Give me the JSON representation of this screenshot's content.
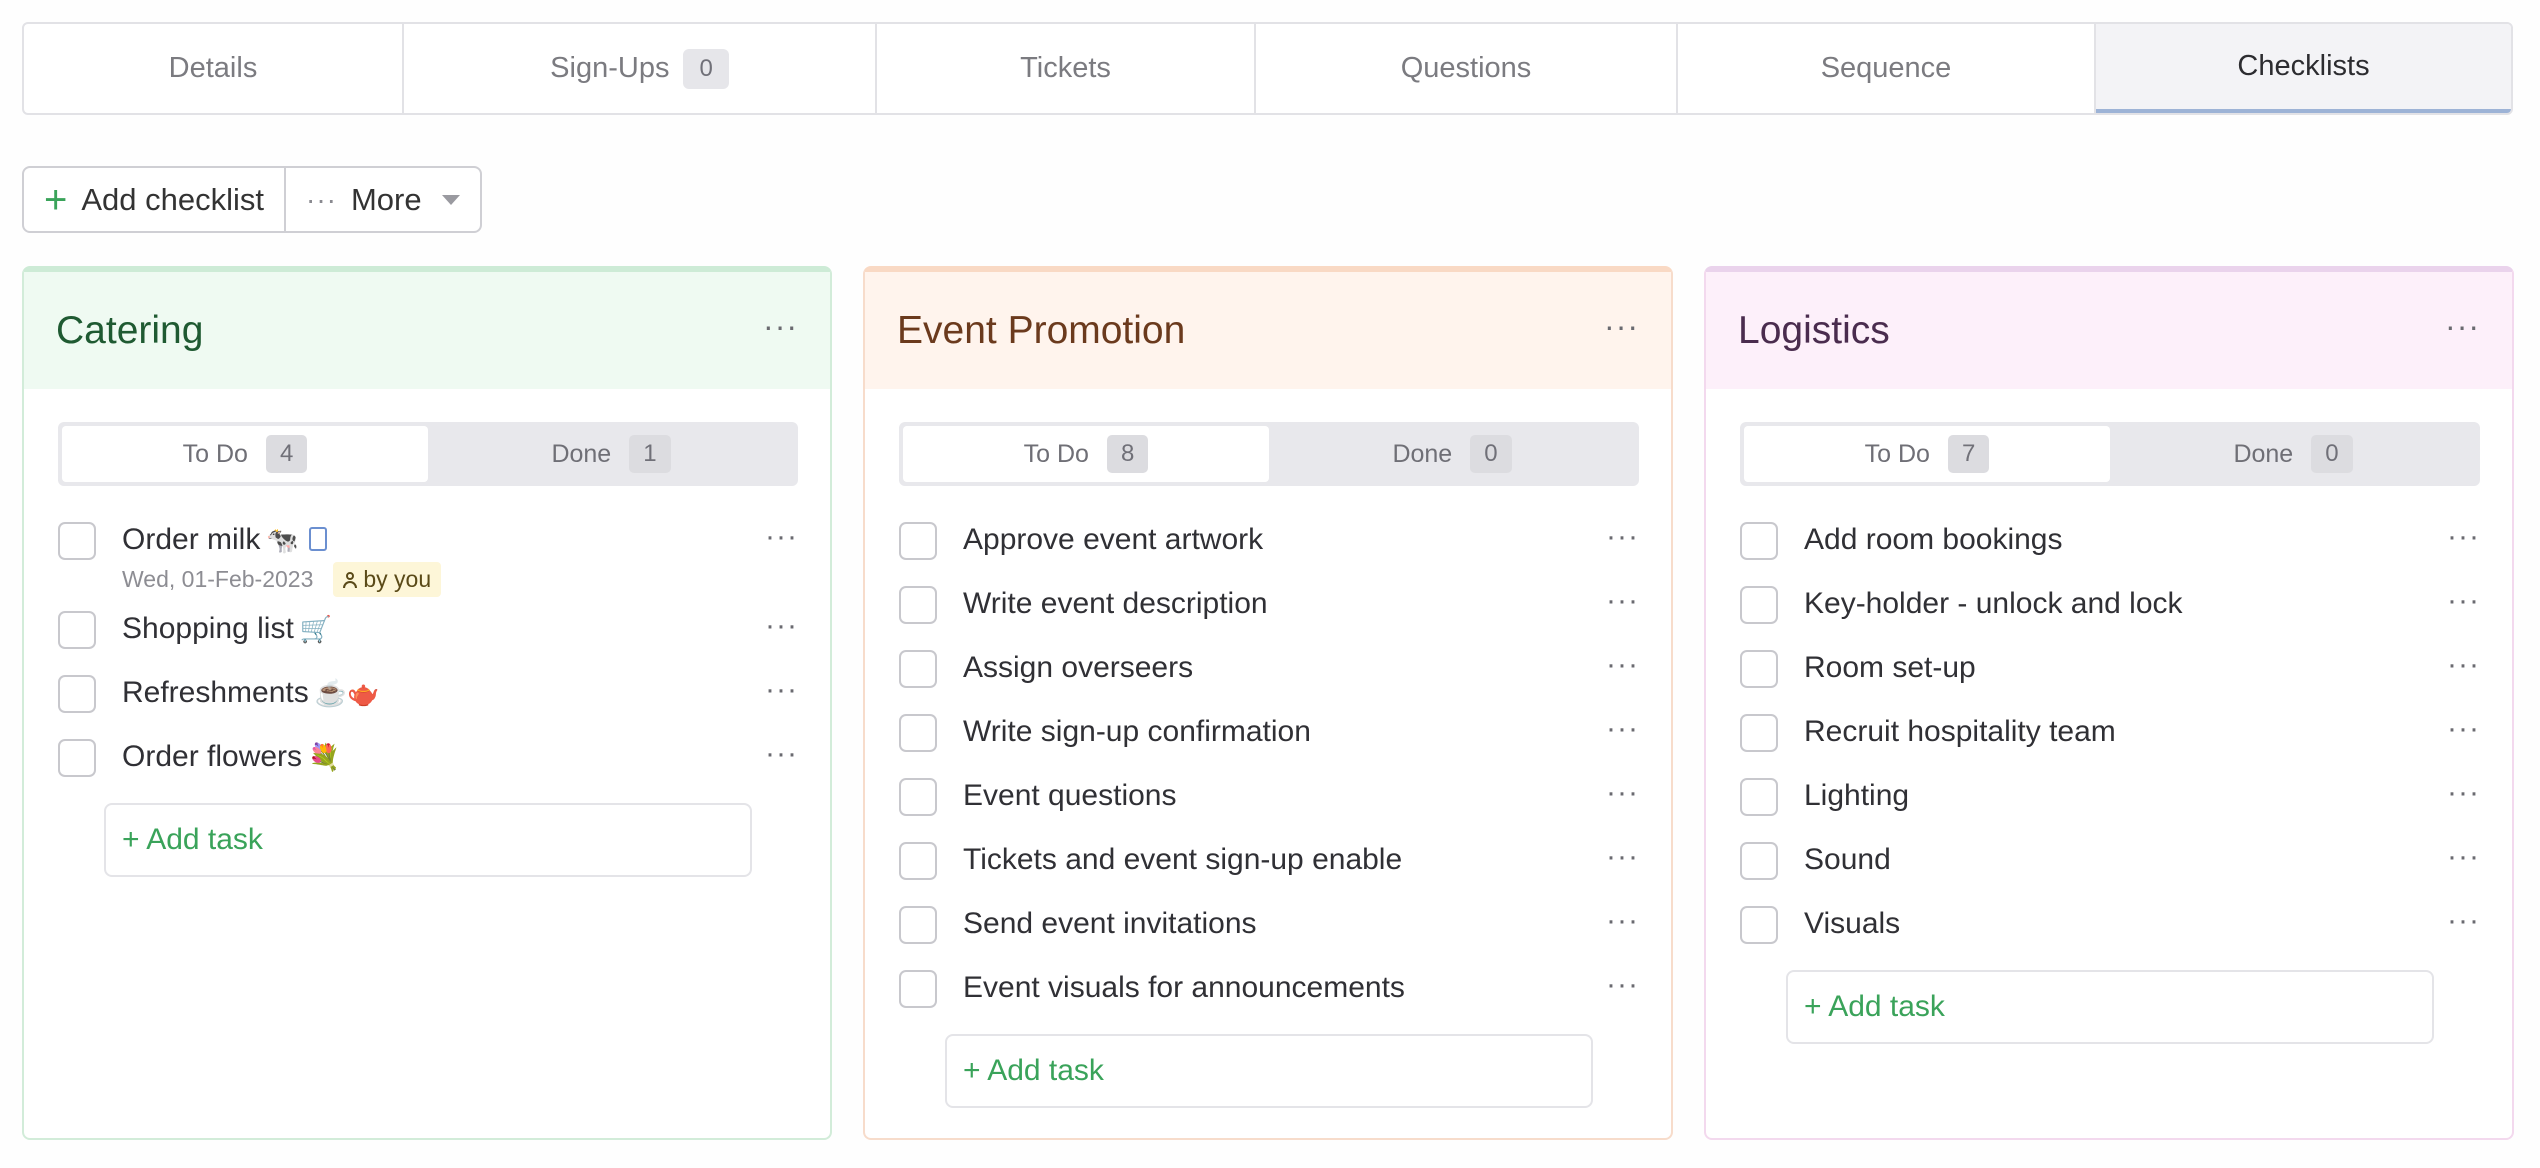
{
  "tabs": [
    {
      "label": "Details",
      "count": null
    },
    {
      "label": "Sign-Ups",
      "count": "0"
    },
    {
      "label": "Tickets",
      "count": null
    },
    {
      "label": "Questions",
      "count": null
    },
    {
      "label": "Sequence",
      "count": null
    },
    {
      "label": "Checklists",
      "count": null,
      "active": true
    }
  ],
  "toolbar": {
    "add_label": "Add checklist",
    "more_label": "More"
  },
  "checklists": [
    {
      "title": "Catering",
      "todo_label": "To Do",
      "todo_count": "4",
      "done_label": "Done",
      "done_count": "1",
      "colors": {
        "accent": "#cdebd6",
        "head_bg": "#effaf2",
        "title": "#1f5a32",
        "border": "#d2ecd9"
      },
      "tasks": [
        {
          "label": "Order milk",
          "emoji": "🐄",
          "has_doc": true,
          "date": "Wed, 01-Feb-2023",
          "badge": "by you"
        },
        {
          "label": "Shopping list",
          "emoji": "🛒"
        },
        {
          "label": "Refreshments",
          "emoji": "☕🫖"
        },
        {
          "label": "Order flowers",
          "emoji": "💐"
        }
      ],
      "add_task": "+ Add task"
    },
    {
      "title": "Event Promotion",
      "todo_label": "To Do",
      "todo_count": "8",
      "done_label": "Done",
      "done_count": "0",
      "colors": {
        "accent": "#f9d9c4",
        "head_bg": "#fff4ed",
        "title": "#6b3a1d",
        "border": "#f7dccb"
      },
      "tasks": [
        {
          "label": "Approve event artwork"
        },
        {
          "label": "Write event description"
        },
        {
          "label": "Assign overseers"
        },
        {
          "label": "Write sign-up confirmation"
        },
        {
          "label": "Event questions"
        },
        {
          "label": "Tickets and event sign-up enable"
        },
        {
          "label": "Send event invitations"
        },
        {
          "label": "Event visuals for announcements"
        }
      ],
      "add_task": "+ Add task"
    },
    {
      "title": "Logistics",
      "todo_label": "To Do",
      "todo_count": "7",
      "done_label": "Done",
      "done_count": "0",
      "colors": {
        "accent": "#ead3ec",
        "head_bg": "#fdf0fa",
        "title": "#4a2c4e",
        "border": "#f3d9ee"
      },
      "tasks": [
        {
          "label": "Add room bookings"
        },
        {
          "label": "Key-holder - unlock and lock"
        },
        {
          "label": "Room set-up"
        },
        {
          "label": "Recruit hospitality team"
        },
        {
          "label": "Lighting"
        },
        {
          "label": "Sound"
        },
        {
          "label": "Visuals"
        }
      ],
      "add_task": "+ Add task"
    }
  ],
  "menu_glyph": "···"
}
